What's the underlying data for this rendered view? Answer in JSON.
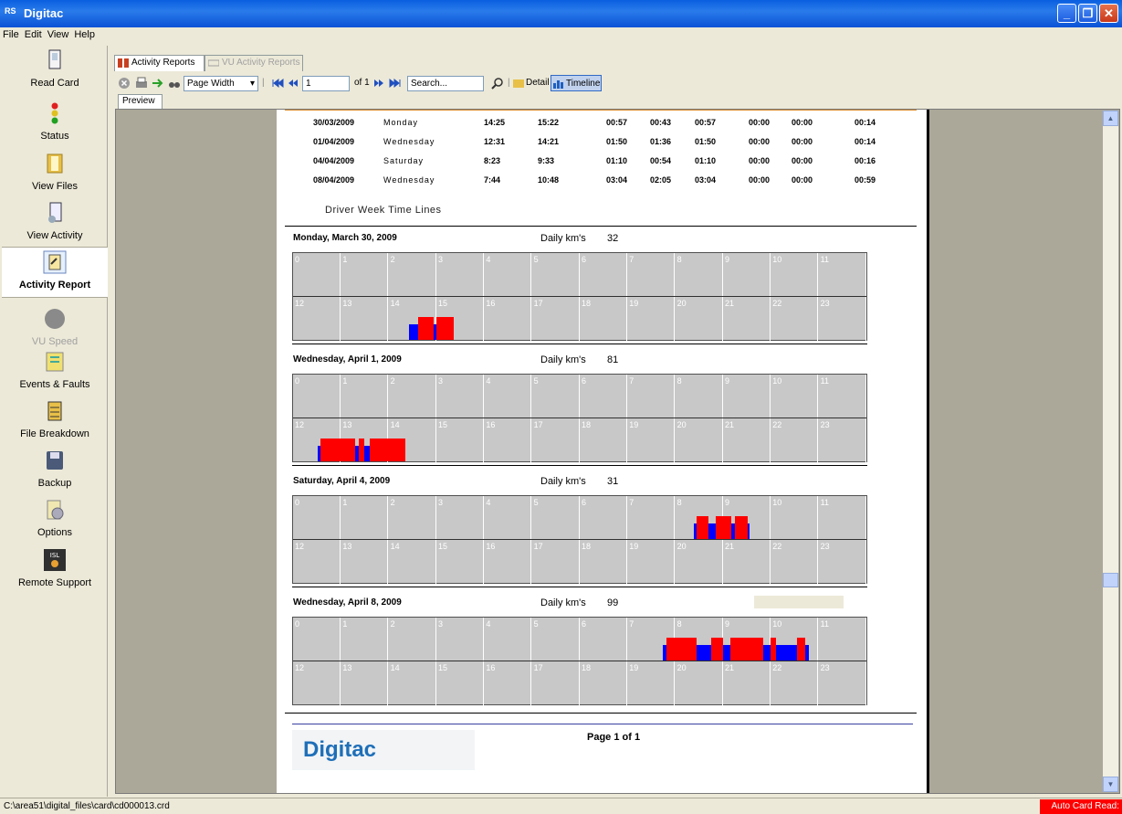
{
  "window": {
    "title": "Digitac",
    "icon_text": "RS"
  },
  "menu": [
    "File",
    "Edit",
    "View",
    "Help"
  ],
  "sidebar": [
    {
      "label": "Read Card",
      "icon": "read-card-icon",
      "state": "normal"
    },
    {
      "label": "Status",
      "icon": "traffic-light-icon",
      "state": "normal"
    },
    {
      "label": "View Files",
      "icon": "folder-icon",
      "state": "normal"
    },
    {
      "label": "View Activity",
      "icon": "view-activity-icon",
      "state": "normal"
    },
    {
      "label": "Activity Report",
      "icon": "activity-report-icon",
      "state": "active"
    },
    {
      "label": "VU Speed",
      "icon": "vu-speed-icon",
      "state": "disabled"
    },
    {
      "label": "Events & Faults",
      "icon": "events-faults-icon",
      "state": "normal"
    },
    {
      "label": "File Breakdown",
      "icon": "file-breakdown-icon",
      "state": "normal"
    },
    {
      "label": "Backup",
      "icon": "floppy-disk-icon",
      "state": "normal"
    },
    {
      "label": "Options",
      "icon": "options-gear-icon",
      "state": "normal"
    },
    {
      "label": "Remote Support",
      "icon": "remote-support-icon",
      "state": "normal"
    }
  ],
  "tabs": {
    "active": "Activity Reports",
    "inactive": "VU Activity Reports"
  },
  "toolbar": {
    "zoom": "Page Width",
    "page": "1",
    "of": "of 1",
    "search_placeholder": "Search...",
    "detail": "Detail",
    "timeline": "Timeline"
  },
  "preview_tab": "Preview",
  "summary_rows": [
    {
      "date": "30/03/2009",
      "day": "Monday",
      "c1": "14:25",
      "c2": "15:22",
      "c3": "00:57",
      "c4": "00:43",
      "c5": "00:57",
      "c6": "00:00",
      "c7": "00:00",
      "c8": "00:14"
    },
    {
      "date": "01/04/2009",
      "day": "Wednesday",
      "c1": "12:31",
      "c2": "14:21",
      "c3": "01:50",
      "c4": "01:36",
      "c5": "01:50",
      "c6": "00:00",
      "c7": "00:00",
      "c8": "00:14"
    },
    {
      "date": "04/04/2009",
      "day": "Saturday",
      "c1": "8:23",
      "c2": "9:33",
      "c3": "01:10",
      "c4": "00:54",
      "c5": "01:10",
      "c6": "00:00",
      "c7": "00:00",
      "c8": "00:16"
    },
    {
      "date": "08/04/2009",
      "day": "Wednesday",
      "c1": "7:44",
      "c2": "10:48",
      "c3": "03:04",
      "c4": "02:05",
      "c5": "03:04",
      "c6": "00:00",
      "c7": "00:00",
      "c8": "00:59"
    }
  ],
  "timelines_heading": "Driver Week Time Lines",
  "km_label": "Daily km's",
  "hours": [
    "0",
    "1",
    "2",
    "3",
    "4",
    "5",
    "6",
    "7",
    "8",
    "9",
    "10",
    "11",
    "12",
    "13",
    "14",
    "15",
    "16",
    "17",
    "18",
    "19",
    "20",
    "21",
    "22",
    "23"
  ],
  "colors": {
    "driving": "#ff0000",
    "work": "#0000ff",
    "grid": "#c8c8c8"
  },
  "days": [
    {
      "title": "Monday, March 30, 2009",
      "km": "32",
      "segments": [
        [
          "work",
          14.42,
          14.62
        ],
        [
          "driving",
          14.62,
          14.95
        ],
        [
          "work",
          14.95,
          15.0
        ],
        [
          "driving",
          15.0,
          15.37
        ]
      ]
    },
    {
      "title": "Wednesday, April 1, 2009",
      "km": "81",
      "segments": [
        [
          "work",
          12.52,
          12.57
        ],
        [
          "driving",
          12.57,
          13.3
        ],
        [
          "work",
          13.3,
          13.38
        ],
        [
          "driving",
          13.38,
          13.5
        ],
        [
          "work",
          13.5,
          13.6
        ],
        [
          "driving",
          13.6,
          14.35
        ]
      ]
    },
    {
      "title": "Saturday, April 4, 2009",
      "km": "31",
      "segments": [
        [
          "work",
          8.38,
          8.45
        ],
        [
          "driving",
          8.45,
          8.7
        ],
        [
          "work",
          8.7,
          8.85
        ],
        [
          "driving",
          8.85,
          9.18
        ],
        [
          "work",
          9.18,
          9.25
        ],
        [
          "driving",
          9.25,
          9.52
        ],
        [
          "work",
          9.52,
          9.55
        ]
      ]
    },
    {
      "title": "Wednesday, April 8, 2009",
      "km": "99",
      "segments": [
        [
          "work",
          7.73,
          7.82
        ],
        [
          "driving",
          7.82,
          8.45
        ],
        [
          "work",
          8.45,
          8.75
        ],
        [
          "driving",
          8.75,
          9.0
        ],
        [
          "work",
          9.0,
          9.15
        ],
        [
          "driving",
          9.15,
          9.85
        ],
        [
          "work",
          9.85,
          10.0
        ],
        [
          "driving",
          10.0,
          10.1
        ],
        [
          "work",
          10.1,
          10.55
        ],
        [
          "driving",
          10.55,
          10.72
        ],
        [
          "work",
          10.72,
          10.8
        ]
      ]
    }
  ],
  "footer": {
    "logo_text": "Digitac",
    "page_text": "Page 1 of 1"
  },
  "status": {
    "path": "C:\\area51\\digital_files\\card\\cd000013.crd",
    "autocard": "Auto Card Read: Off"
  }
}
